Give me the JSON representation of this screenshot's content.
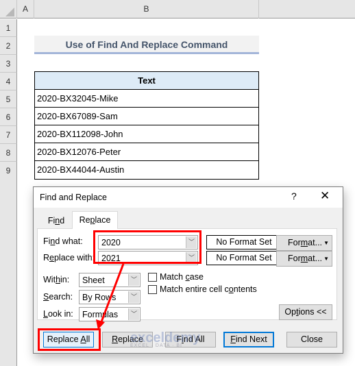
{
  "sheet": {
    "columns": [
      "A",
      "B"
    ],
    "rows": [
      "1",
      "2",
      "3",
      "4",
      "5",
      "6",
      "7",
      "8",
      "9"
    ],
    "title": "Use of Find And Replace Command",
    "table": {
      "header": "Text",
      "cells": [
        "2020-BX32045-Mike",
        "2020-BX67089-Sam",
        "2020-BX112098-John",
        "2020-BX12076-Peter",
        "2020-BX44044-Austin"
      ]
    }
  },
  "dialog": {
    "title": "Find and Replace",
    "help_label": "?",
    "close_label": "✕",
    "tabs": [
      {
        "label": "Find",
        "active": false
      },
      {
        "label": "Replace",
        "active": true
      }
    ],
    "find_what": {
      "label": "Find what:",
      "value": "2020",
      "format_status": "No Format Set",
      "format_button": "Format..."
    },
    "replace_with": {
      "label": "Replace with:",
      "value": "2021",
      "format_status": "No Format Set",
      "format_button": "Format..."
    },
    "within": {
      "label": "Within:",
      "value": "Sheet"
    },
    "search": {
      "label": "Search:",
      "value": "By Rows"
    },
    "look_in": {
      "label": "Look in:",
      "value": "Formulas"
    },
    "match_case": {
      "label": "Match case",
      "checked": false
    },
    "match_entire": {
      "label": "Match entire cell contents",
      "checked": false
    },
    "options_button": "Options <<",
    "buttons": {
      "replace_all": "Replace All",
      "replace": "Replace",
      "find_all": "Find All",
      "find_next": "Find Next",
      "close": "Close"
    }
  },
  "watermark": {
    "brand": "exceldemy",
    "tagline": "EXCEL · DATA · BI"
  },
  "colors": {
    "highlight": "#ff0000",
    "focus": "#0078d7",
    "header_fill": "#ddebf7",
    "title_text": "#44546a"
  }
}
